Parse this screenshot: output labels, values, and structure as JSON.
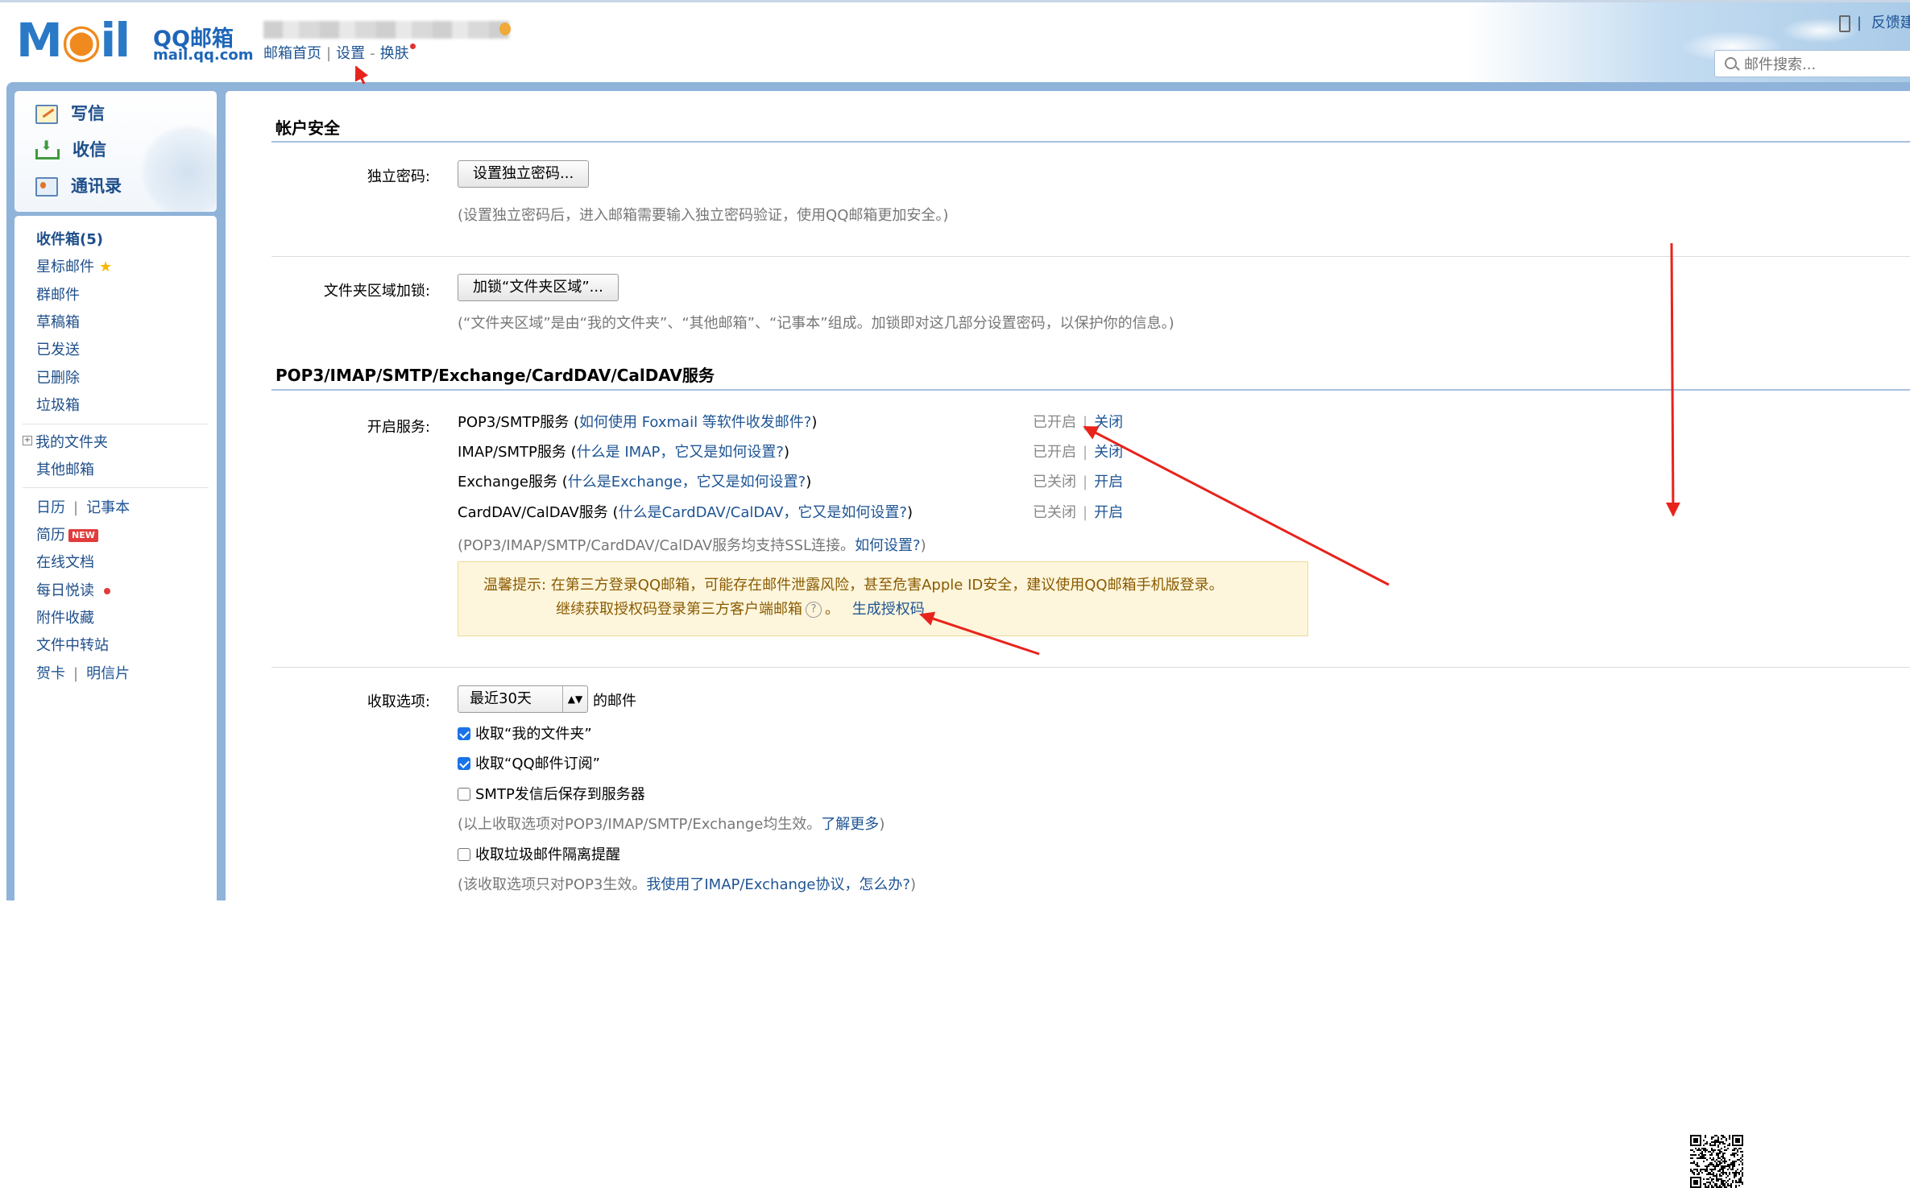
{
  "header": {
    "logo_text_mail": "M",
    "logo_text_il": "il",
    "logo_title": "QQ邮箱",
    "logo_domain": "mail.qq.com",
    "nav_home": "邮箱首页",
    "nav_sep": "|",
    "nav_settings": "设置",
    "nav_dash": "-",
    "nav_skin": "换肤",
    "top_right_sep": "|",
    "top_right_feedback": "反馈建",
    "search_placeholder": "邮件搜索..."
  },
  "quick_links": {
    "compose": "写信",
    "inbox": "收信",
    "contacts": "通讯录"
  },
  "folders": {
    "inbox": "收件箱(5)",
    "starred": "星标邮件",
    "group": "群邮件",
    "drafts": "草稿箱",
    "sent": "已发送",
    "deleted": "已删除",
    "spam": "垃圾箱",
    "my_folders": "我的文件夹",
    "other_mailboxes": "其他邮箱",
    "calendar": "日历",
    "notes": "记事本",
    "resume": "简历",
    "resume_badge": "NEW",
    "online_docs": "在线文档",
    "daily_reading": "每日悦读",
    "attachments": "附件收藏",
    "file_transfer": "文件中转站",
    "cards": "贺卡",
    "postcards": "明信片",
    "sep": "|"
  },
  "account_security": {
    "title": "帐户安全",
    "password_label": "独立密码:",
    "password_button": "设置独立密码...",
    "password_hint": "(设置独立密码后，进入邮箱需要输入独立密码验证，使用QQ邮箱更加安全。)",
    "folder_lock_label": "文件夹区域加锁:",
    "folder_lock_button": "加锁“文件夹区域”...",
    "folder_lock_hint": "(“文件夹区域”是由“我的文件夹”、“其他邮箱”、“记事本”组成。加锁即对这几部分设置密码，以保护你的信息。)"
  },
  "services": {
    "title": "POP3/IMAP/SMTP/Exchange/CardDAV/CalDAV服务",
    "label": "开启服务:",
    "items": [
      {
        "name": "POP3/SMTP服务",
        "paren_open": "(",
        "help": "如何使用 Foxmail 等软件收发邮件?",
        "paren_close": ")",
        "status": "已开启",
        "action": "关闭"
      },
      {
        "name": "IMAP/SMTP服务",
        "paren_open": "(",
        "help": "什么是 IMAP，它又是如何设置?",
        "paren_close": ")",
        "status": "已开启",
        "action": "关闭"
      },
      {
        "name": "Exchange服务",
        "paren_open": "(",
        "help": "什么是Exchange，它又是如何设置?",
        "paren_close": ")",
        "status": "已关闭",
        "action": "开启"
      },
      {
        "name": "CardDAV/CalDAV服务",
        "paren_open": "(",
        "help": "什么是CardDAV/CalDAV，它又是如何设置?",
        "paren_close": ")",
        "status": "已关闭",
        "action": "开启"
      }
    ],
    "status_sep": "|",
    "ssl_hint": "(POP3/IMAP/SMTP/CardDAV/CalDAV服务均支持SSL连接。",
    "ssl_link": "如何设置?",
    "ssl_hint_close": ")",
    "tip_line1": "温馨提示: 在第三方登录QQ邮箱，可能存在邮件泄露风险，甚至危害Apple ID安全，建议使用QQ邮箱手机版登录。",
    "tip_line2": "继续获取授权码登录第三方客户端邮箱",
    "tip_help": "?",
    "tip_period": "。",
    "tip_link": "生成授权码"
  },
  "receive_options": {
    "label": "收取选项:",
    "select_value": "最近30天",
    "select_suffix": "的邮件",
    "opt_my_folders": "收取“我的文件夹”",
    "opt_subscriptions": "收取“QQ邮件订阅”",
    "opt_smtp_save": "SMTP发信后保存到服务器",
    "hint1": "(以上收取选项对POP3/IMAP/SMTP/Exchange均生效。",
    "hint1_link": "了解更多",
    "hint1_close": ")",
    "opt_spam_alert": "收取垃圾邮件隔离提醒",
    "hint2": "(该收取选项只对POP3生效。",
    "hint2_link": "我使用了IMAP/Exchange协议，怎么办?",
    "hint2_close": ")",
    "checked": {
      "my_folders": true,
      "subscriptions": true,
      "smtp_save": false,
      "spam_alert": false
    }
  },
  "colors": {
    "link": "#1e5494",
    "frame": "#8fb3d9",
    "annotation": "#e8231c"
  }
}
